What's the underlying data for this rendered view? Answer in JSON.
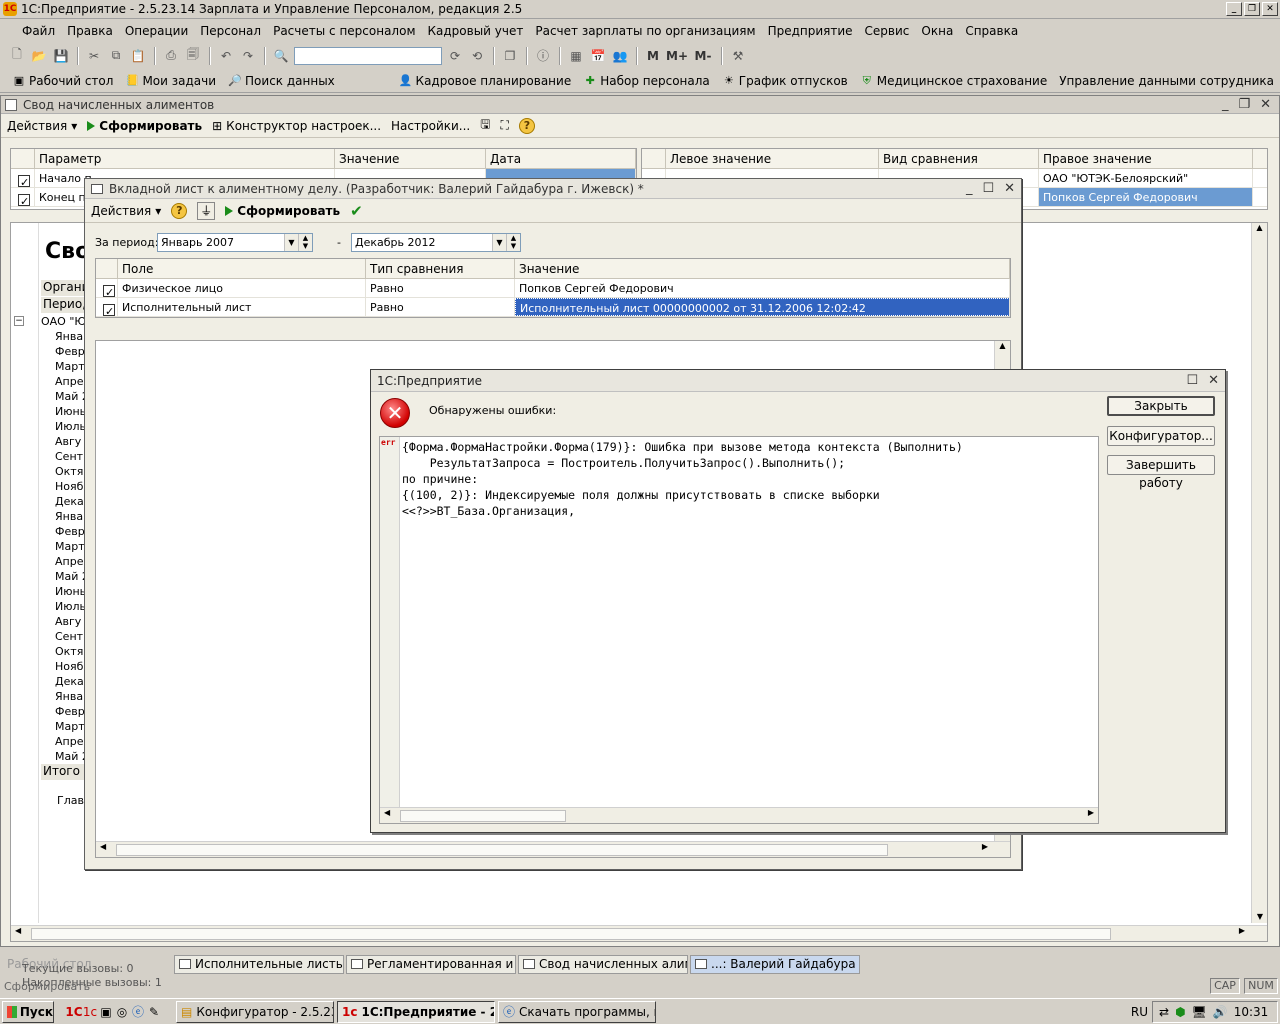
{
  "app": {
    "title": "1С:Предприятие - 2.5.23.14 Зарплата и Управление Персоналом, редакция 2.5"
  },
  "menu": [
    "Файл",
    "Правка",
    "Операции",
    "Персонал",
    "Расчеты с персоналом",
    "Кадровый учет",
    "Расчет зарплаты по организациям",
    "Предприятие",
    "Сервис",
    "Окна",
    "Справка"
  ],
  "toolbar": {
    "m": "M",
    "mplus": "M+",
    "mminus": "M-"
  },
  "links": [
    "Рабочий стол",
    "Мои задачи",
    "Поиск данных",
    "Кадровое планирование",
    "Набор персонала",
    "График отпусков",
    "Медицинское страхование",
    "Управление данными сотрудника"
  ],
  "main_window": {
    "title": "Свод начисленных алиментов",
    "actions": "Действия",
    "generate": "Сформировать",
    "constructor": "Конструктор настроек...",
    "settings": "Настройки...",
    "params_grid": {
      "headers": [
        "Параметр",
        "Значение",
        "Дата"
      ],
      "rows": [
        {
          "param": "Начало п"
        },
        {
          "param": "Конец пе"
        }
      ]
    },
    "filter_grid": {
      "headers": [
        "Левое значение",
        "Вид сравнения",
        "Правое значение"
      ],
      "rows": [
        {
          "right": "ОАО \"ЮТЭК-Белоярский\""
        },
        {
          "right": "Попков Сергей Федорович"
        }
      ]
    },
    "report": {
      "title": "Сво",
      "org_label": "Органи",
      "period_label": "Перио,",
      "org_row": "ОАО \"Ю",
      "months": [
        "Янва",
        "Февр",
        "Март",
        "Апре",
        "Май 2",
        "Июнь",
        "Июль",
        "Авгу",
        "Сент",
        "Октя",
        "Нояб",
        "Дека",
        "Янва",
        "Февр",
        "Март",
        "Апре",
        "Май 2",
        "Июнь",
        "Июль",
        "Авгу",
        "Сент",
        "Октя",
        "Нояб",
        "Дека",
        "Янва",
        "Февр",
        "Март",
        "Апре",
        "Май 2"
      ],
      "total": "Итого",
      "chief": "Глав"
    }
  },
  "dialog1": {
    "title": "Вкладной лист к алиментному делу. (Разработчик: Валерий Гайдабура г. Ижевск) *",
    "actions": "Действия",
    "generate": "Сформировать",
    "period_label": "За период:",
    "period_from": "Январь 2007",
    "period_sep": "-",
    "period_to": "Декабрь 2012",
    "grid": {
      "headers": [
        "Поле",
        "Тип сравнения",
        "Значение"
      ],
      "rows": [
        {
          "field": "Физическое лицо",
          "cmp": "Равно",
          "value": "Попков Сергей Федорович"
        },
        {
          "field": "Исполнительный лист",
          "cmp": "Равно",
          "value": "Исполнительный лист 00000000002 от 31.12.2006 12:02:42"
        }
      ]
    }
  },
  "error_dialog": {
    "title": "1С:Предприятие",
    "message": "Обнаружены ошибки:",
    "btn_close": "Закрыть",
    "btn_configurator": "Конфигуратор...",
    "btn_exit": "Завершить работу",
    "err_tag": "err",
    "code_lines": [
      "{Форма.ФормаНастройки.Форма(179)}: Ошибка при вызове метода контекста (Выполнить)",
      "    РезультатЗапроса = Построитель.ПолучитьЗапрос().Выполнить();",
      "по причине:",
      "{(100, 2)}: Индексируемые поля должны присутствовать в списке выборки",
      "<<?>>ВТ_База.Организация,"
    ]
  },
  "window_tabs": [
    "Рабочий стол",
    "Исполнительные листы [Ис...",
    "Регламентированная и фин...",
    "Свод начисленных алимент...",
    "...: Валерий Гайдабура г. И..."
  ],
  "status": {
    "current_calls": "Текущие вызовы: 0",
    "accumulated_calls": "Накопленные вызовы: 1",
    "generating": "Сформировать",
    "cap": "CAP",
    "num": "NUM"
  },
  "taskbar": {
    "start": "Пуск",
    "tasks": [
      "Конфигуратор - 2.5.23....",
      "1С:Предприятие - 2.5....",
      "Скачать программы, ко..."
    ],
    "lang": "RU",
    "time": "10:31"
  }
}
